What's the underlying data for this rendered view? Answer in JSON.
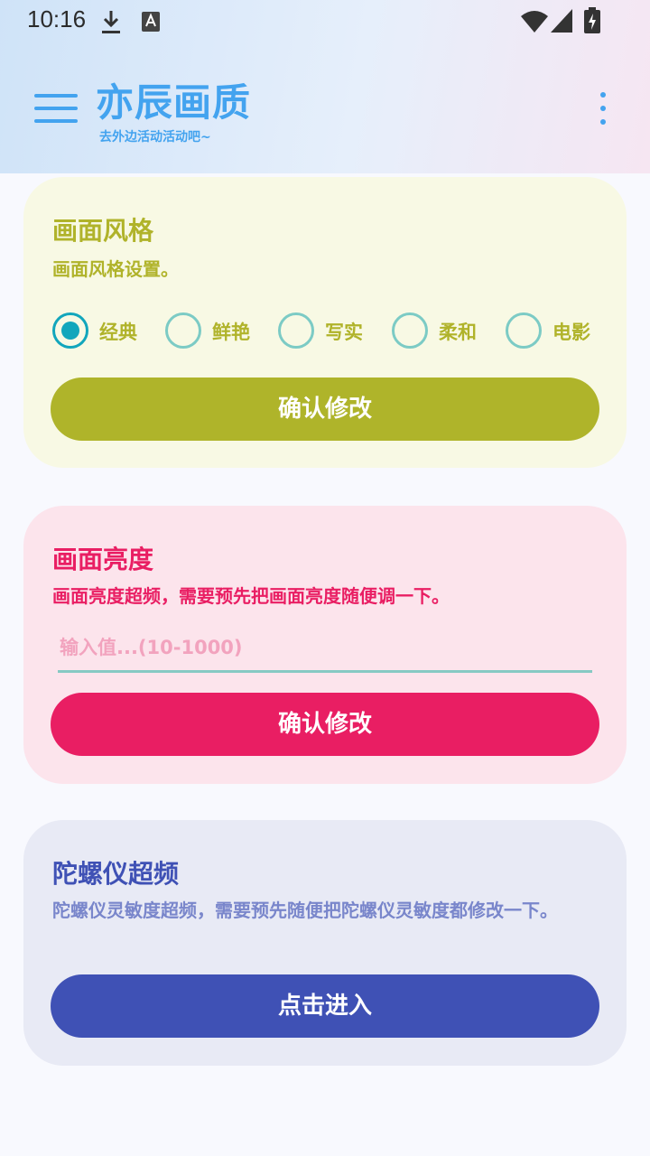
{
  "status_bar": {
    "time": "10:16"
  },
  "app_bar": {
    "title": "亦辰画质",
    "subtitle": "去外边活动活动吧~"
  },
  "style_card": {
    "title": "画面风格",
    "description": "画面风格设置。",
    "options": [
      "经典",
      "鲜艳",
      "写实",
      "柔和",
      "电影"
    ],
    "selected": "经典",
    "button": "确认修改"
  },
  "brightness_card": {
    "title": "画面亮度",
    "description": "画面亮度超频，需要预先把画面亮度随便调一下。",
    "input_placeholder": "输入值...(10-1000)",
    "input_value": "",
    "button": "确认修改"
  },
  "gyro_card": {
    "title": "陀螺仪超频",
    "description": "陀螺仪灵敏度超频，需要预先随便把陀螺仪灵敏度都修改一下。",
    "button": "点击进入"
  },
  "colors": {
    "style_accent": "#afb42a",
    "brightness_accent": "#e91e63",
    "gyro_accent": "#3f51b5",
    "title_blue": "#43a3ef",
    "radio_checked": "#12a6bc"
  }
}
